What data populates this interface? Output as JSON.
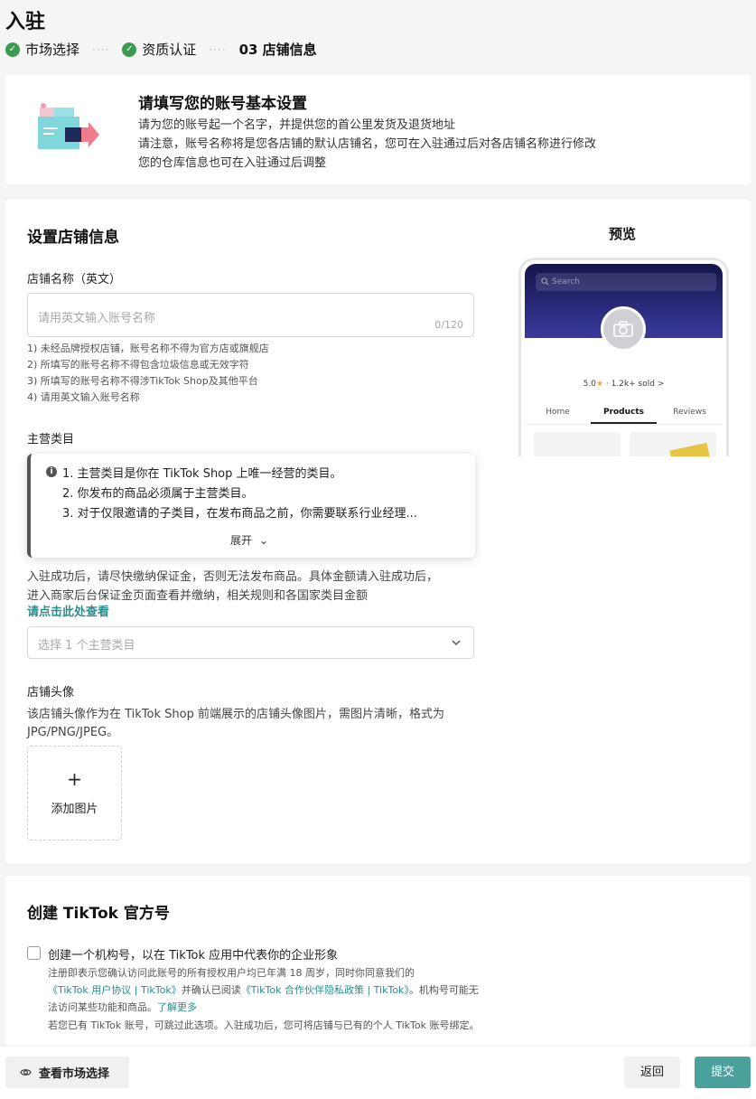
{
  "page": {
    "title": "入驻"
  },
  "steps": [
    {
      "label": "市场选择",
      "state": "done"
    },
    {
      "label": "资质认证",
      "state": "done"
    },
    {
      "label": "03 店铺信息",
      "state": "active"
    }
  ],
  "intro": {
    "title": "请填写您的账号基本设置",
    "lines": [
      "请为您的账号起一个名字，并提供您的首公里发货及退货地址",
      "请注意，账号名称将是您各店铺的默认店铺名，您可在入驻通过后对各店铺名称进行修改",
      "您的仓库信息也可在入驻通过后调整"
    ]
  },
  "shop": {
    "section_title": "设置店铺信息",
    "name": {
      "label": "店铺名称（英文）",
      "placeholder": "请用英文输入账号名称",
      "counter": "0/120",
      "rules": [
        "1) 未经品牌授权店铺，账号名称不得为官方店或旗舰店",
        "2) 所填写的账号名称不得包含垃圾信息或无效字符",
        "3) 所填写的账号名称不得涉TikTok Shop及其他平台",
        "4) 请用英文输入账号名称"
      ]
    },
    "category": {
      "label": "主营类目",
      "tips": [
        "1. 主营类目是你在 TikTok Shop 上唯一经营的类目。",
        "2. 你发布的商品必须属于主营类目。",
        "3. 对于仅限邀请的子类目，在发布商品之前，你需要联系行业经理..."
      ],
      "expand": "展开",
      "note_lines": [
        "入驻成功后，请尽快缴纳保证金，否则无法发布商品。具体金额请入驻成功后，",
        "进入商家后台保证金页面查看并缴纳，相关规则和各国家类目金额"
      ],
      "link": "请点击此处查看",
      "select_placeholder": "选择 1 个主营类目"
    },
    "avatar": {
      "label": "店铺头像",
      "desc_lines": [
        "该店铺头像作为在 TikTok Shop 前端展示的店铺头像图片，需图片清晰，格式为",
        "JPG/PNG/JPEG。"
      ],
      "upload_plus": "+",
      "upload_label": "添加图片"
    },
    "preview": {
      "title": "预览",
      "search": "Search",
      "rating": "5.0",
      "star": "★",
      "sold": "· 1.2k+ sold >",
      "tabs": [
        "Home",
        "Products",
        "Reviews"
      ],
      "active_tab": "Products"
    }
  },
  "official": {
    "title": "创建 TikTok 官方号",
    "option": "创建一个机构号，以在 TikTok 应用中代表你的企业形象",
    "line1": "注册即表示您确认访问此账号的所有授权用户均已年满 18 周岁，同时你同意我们的",
    "link1": "《TikTok 用户协议 | TikTok》",
    "mid1": "并确认已阅读",
    "link2": "《TikTok 合作伙伴隐私政策 | TikTok》",
    "tail1": "。机构号可能无",
    "line3a": "法访问某些功能和商品。",
    "learn_more": "了解更多",
    "line4": "若您已有 TikTok 账号，可跳过此选项。入驻成功后，您可将店铺与已有的个人 TikTok 账号绑定。"
  },
  "footer": {
    "view_market": "查看市场选择",
    "back": "返回",
    "submit": "提交"
  },
  "colors": {
    "accent": "#4ba19c",
    "link": "#2a8c8c",
    "success": "#3a9a52"
  }
}
